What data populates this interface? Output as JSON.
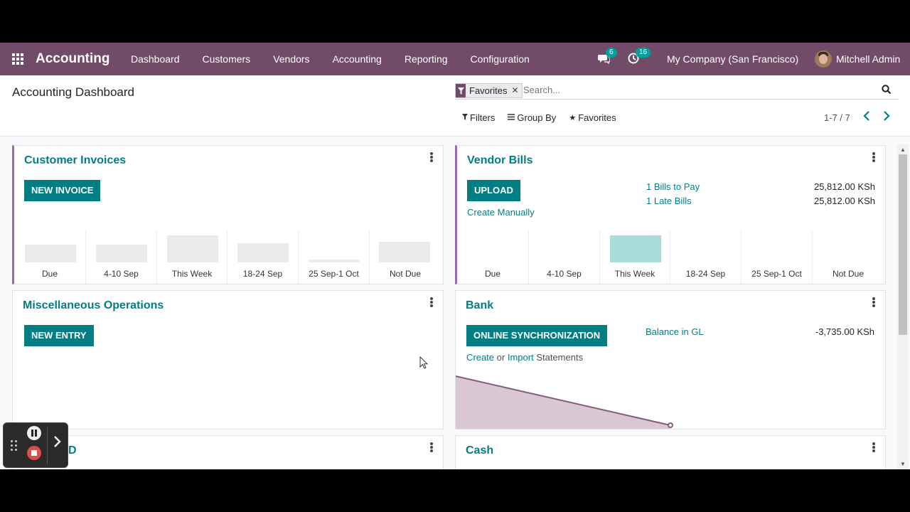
{
  "navbar": {
    "app_name": "Accounting",
    "menu": [
      "Dashboard",
      "Customers",
      "Vendors",
      "Accounting",
      "Reporting",
      "Configuration"
    ],
    "messages_count": "6",
    "activities_count": "16",
    "company": "My Company (San Francisco)",
    "user": "Mitchell Admin",
    "color": "#714b67"
  },
  "control_panel": {
    "title": "Accounting Dashboard",
    "facet_label": "Favorites",
    "search_placeholder": "Search...",
    "filters_label": "Filters",
    "groupby_label": "Group By",
    "favorites_label": "Favorites",
    "pager": "1-7 / 7"
  },
  "cards": {
    "customer_invoices": {
      "title": "Customer Invoices",
      "button": "NEW INVOICE",
      "graph_labels": [
        "Due",
        "4-10 Sep",
        "This Week",
        "18-24 Sep",
        "25 Sep-1 Oct",
        "Not Due"
      ]
    },
    "vendor_bills": {
      "title": "Vendor Bills",
      "button": "UPLOAD",
      "create_link": "Create Manually",
      "stats": [
        {
          "label": "1 Bills to Pay",
          "value": "25,812.00 KSh"
        },
        {
          "label": "1 Late Bills",
          "value": "25,812.00 KSh"
        }
      ],
      "graph_labels": [
        "Due",
        "4-10 Sep",
        "This Week",
        "18-24 Sep",
        "25 Sep-1 Oct",
        "Not Due"
      ]
    },
    "misc_operations": {
      "title": "Miscellaneous Operations",
      "button": "NEW ENTRY"
    },
    "bank": {
      "title": "Bank",
      "button": "ONLINE SYNCHRONIZATION",
      "create_link": "Create",
      "or_text": "or",
      "import_link": "Import",
      "statements_text": "Statements",
      "balance_label": "Balance in GL",
      "balance_value": "-3,735.00 KSh"
    },
    "partial_card": {
      "title_fragment": "D"
    },
    "cash": {
      "title": "Cash"
    }
  },
  "colors": {
    "accent": "#017e84",
    "highlight_bar": "#a8ddd9",
    "sidebar_accent": "#9c69b0"
  }
}
